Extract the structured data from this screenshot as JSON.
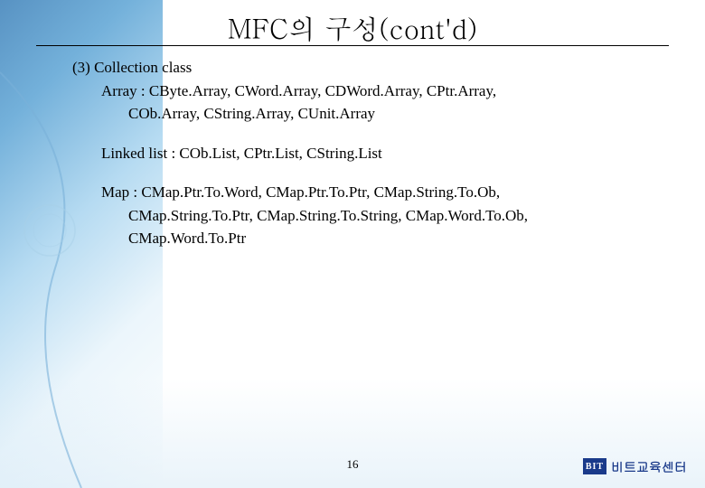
{
  "title": "MFC의 구성(cont'd)",
  "section": {
    "number": "(3)",
    "heading": "Collection class",
    "array": {
      "label": "Array :",
      "line1": "CByte.Array, CWord.Array, CDWord.Array, CPtr.Array,",
      "line2": "COb.Array,   CString.Array, CUnit.Array"
    },
    "linkedlist": {
      "label": "Linked list :",
      "line1": "COb.List, CPtr.List, CString.List"
    },
    "map": {
      "label": "Map :",
      "line1": "CMap.Ptr.To.Word,  CMap.Ptr.To.Ptr,       CMap.String.To.Ob,",
      "line2": "CMap.String.To.Ptr, CMap.String.To.String, CMap.Word.To.Ob,",
      "line3": "CMap.Word.To.Ptr"
    }
  },
  "page_number": "16",
  "footer": {
    "logo_abbr": "BIT",
    "logo_text": "비트교육센터"
  }
}
